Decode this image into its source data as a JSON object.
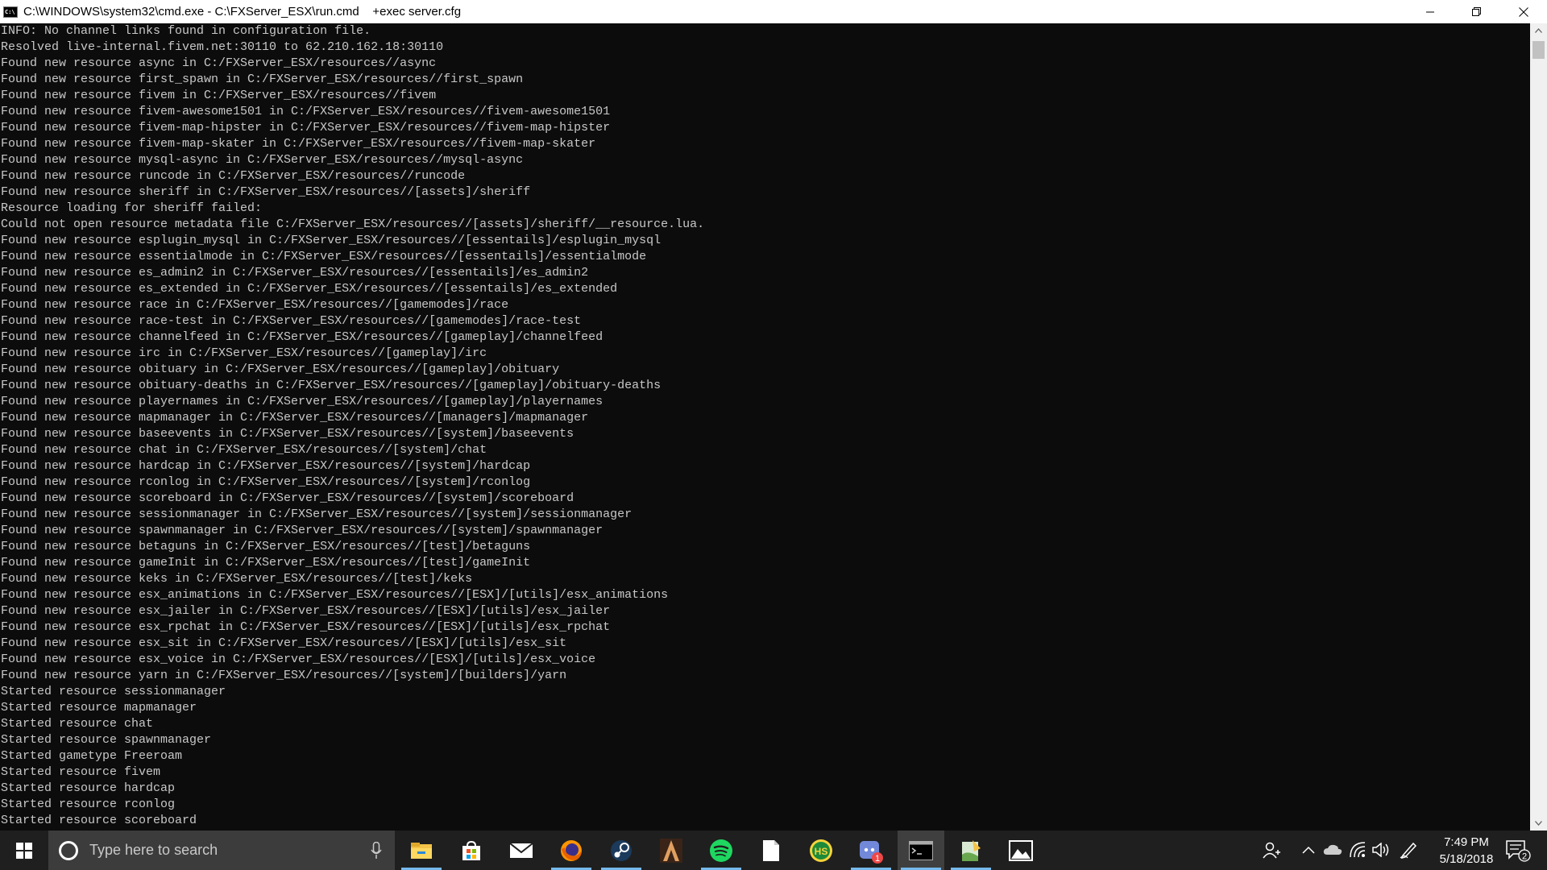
{
  "window": {
    "title": "C:\\WINDOWS\\system32\\cmd.exe - C:\\FXServer_ESX\\run.cmd    +exec server.cfg",
    "app_icon_text": "C:\\"
  },
  "console": {
    "lines": [
      "INFO: No channel links found in configuration file.",
      "Resolved live-internal.fivem.net:30110 to 62.210.162.18:30110",
      "Found new resource async in C:/FXServer_ESX/resources//async",
      "Found new resource first_spawn in C:/FXServer_ESX/resources//first_spawn",
      "Found new resource fivem in C:/FXServer_ESX/resources//fivem",
      "Found new resource fivem-awesome1501 in C:/FXServer_ESX/resources//fivem-awesome1501",
      "Found new resource fivem-map-hipster in C:/FXServer_ESX/resources//fivem-map-hipster",
      "Found new resource fivem-map-skater in C:/FXServer_ESX/resources//fivem-map-skater",
      "Found new resource mysql-async in C:/FXServer_ESX/resources//mysql-async",
      "Found new resource runcode in C:/FXServer_ESX/resources//runcode",
      "Found new resource sheriff in C:/FXServer_ESX/resources//[assets]/sheriff",
      "Resource loading for sheriff failed:",
      "Could not open resource metadata file C:/FXServer_ESX/resources//[assets]/sheriff/__resource.lua.",
      "Found new resource esplugin_mysql in C:/FXServer_ESX/resources//[essentails]/esplugin_mysql",
      "Found new resource essentialmode in C:/FXServer_ESX/resources//[essentails]/essentialmode",
      "Found new resource es_admin2 in C:/FXServer_ESX/resources//[essentails]/es_admin2",
      "Found new resource es_extended in C:/FXServer_ESX/resources//[essentails]/es_extended",
      "Found new resource race in C:/FXServer_ESX/resources//[gamemodes]/race",
      "Found new resource race-test in C:/FXServer_ESX/resources//[gamemodes]/race-test",
      "Found new resource channelfeed in C:/FXServer_ESX/resources//[gameplay]/channelfeed",
      "Found new resource irc in C:/FXServer_ESX/resources//[gameplay]/irc",
      "Found new resource obituary in C:/FXServer_ESX/resources//[gameplay]/obituary",
      "Found new resource obituary-deaths in C:/FXServer_ESX/resources//[gameplay]/obituary-deaths",
      "Found new resource playernames in C:/FXServer_ESX/resources//[gameplay]/playernames",
      "Found new resource mapmanager in C:/FXServer_ESX/resources//[managers]/mapmanager",
      "Found new resource baseevents in C:/FXServer_ESX/resources//[system]/baseevents",
      "Found new resource chat in C:/FXServer_ESX/resources//[system]/chat",
      "Found new resource hardcap in C:/FXServer_ESX/resources//[system]/hardcap",
      "Found new resource rconlog in C:/FXServer_ESX/resources//[system]/rconlog",
      "Found new resource scoreboard in C:/FXServer_ESX/resources//[system]/scoreboard",
      "Found new resource sessionmanager in C:/FXServer_ESX/resources//[system]/sessionmanager",
      "Found new resource spawnmanager in C:/FXServer_ESX/resources//[system]/spawnmanager",
      "Found new resource betaguns in C:/FXServer_ESX/resources//[test]/betaguns",
      "Found new resource gameInit in C:/FXServer_ESX/resources//[test]/gameInit",
      "Found new resource keks in C:/FXServer_ESX/resources//[test]/keks",
      "Found new resource esx_animations in C:/FXServer_ESX/resources//[ESX]/[utils]/esx_animations",
      "Found new resource esx_jailer in C:/FXServer_ESX/resources//[ESX]/[utils]/esx_jailer",
      "Found new resource esx_rpchat in C:/FXServer_ESX/resources//[ESX]/[utils]/esx_rpchat",
      "Found new resource esx_sit in C:/FXServer_ESX/resources//[ESX]/[utils]/esx_sit",
      "Found new resource esx_voice in C:/FXServer_ESX/resources//[ESX]/[utils]/esx_voice",
      "Found new resource yarn in C:/FXServer_ESX/resources//[system]/[builders]/yarn",
      "Started resource sessionmanager",
      "Started resource mapmanager",
      "Started resource chat",
      "Started resource spawnmanager",
      "Started gametype Freeroam",
      "Started resource fivem",
      "Started resource hardcap",
      "Started resource rconlog",
      "Started resource scoreboard"
    ]
  },
  "taskbar": {
    "search_placeholder": "Type here to search",
    "apps": [
      {
        "name": "file-explorer-icon",
        "active": false,
        "running": true
      },
      {
        "name": "store-icon",
        "active": false,
        "running": false
      },
      {
        "name": "mail-icon",
        "active": false,
        "running": false
      },
      {
        "name": "firefox-icon",
        "active": false,
        "running": true
      },
      {
        "name": "steam-icon",
        "active": false,
        "running": true
      },
      {
        "name": "game-launcher-icon",
        "active": false,
        "running": false
      },
      {
        "name": "spotify-icon",
        "active": false,
        "running": true
      },
      {
        "name": "blank-document-icon",
        "active": false,
        "running": false
      },
      {
        "name": "hs-app-icon",
        "active": false,
        "running": false
      },
      {
        "name": "discord-icon",
        "active": false,
        "running": true
      },
      {
        "name": "cmd-icon",
        "active": true,
        "running": true
      },
      {
        "name": "notepad-plus-icon",
        "active": false,
        "running": true
      },
      {
        "name": "photos-icon",
        "active": false,
        "running": false
      }
    ],
    "discord_badge": "1",
    "hs_badge": "HS",
    "clock_time": "7:49 PM",
    "clock_date": "5/18/2018",
    "notification_count": "2"
  },
  "colors": {
    "console_bg": "#0c0c0c",
    "console_text": "#c8c8c8",
    "taskbar_bg": "#1f1f1f",
    "accent": "#76b9ed"
  }
}
